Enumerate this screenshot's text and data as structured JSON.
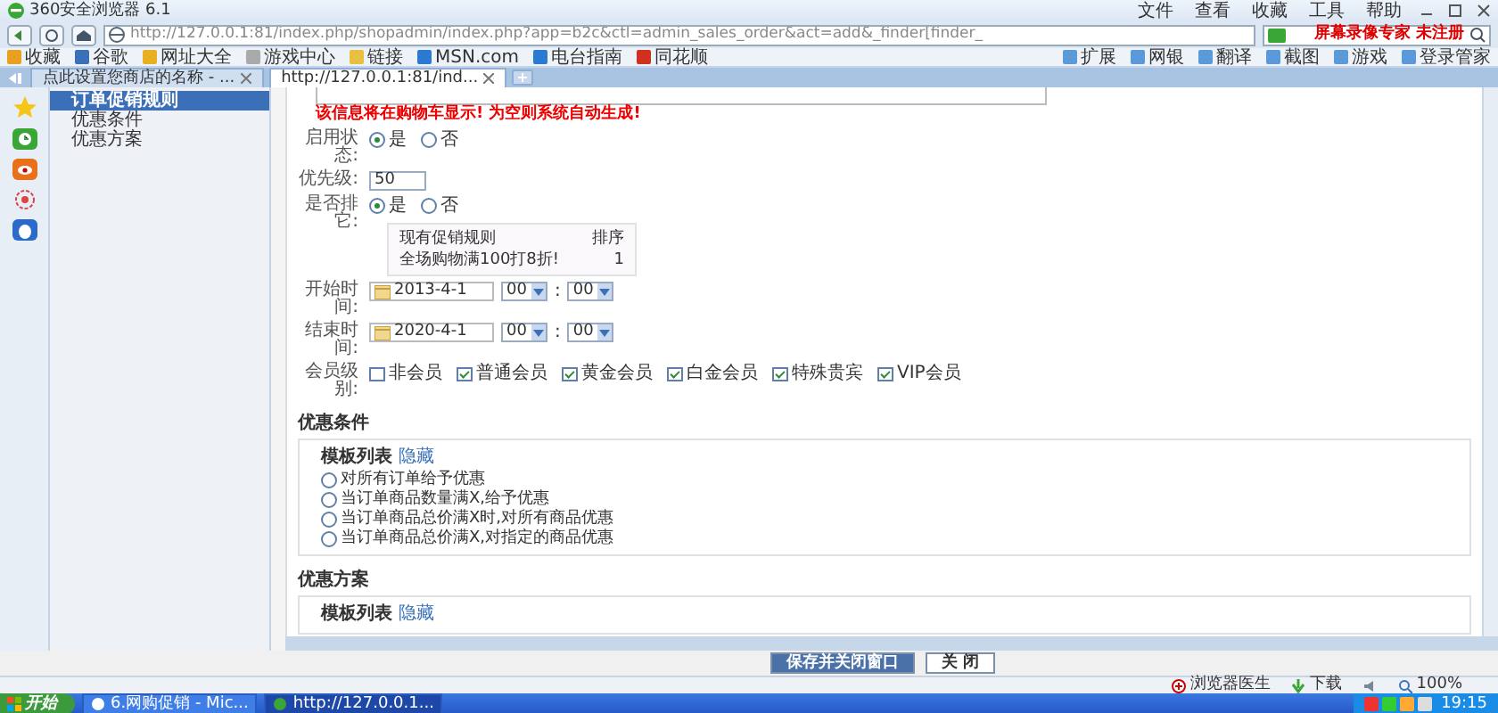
{
  "window": {
    "title": "360安全浏览器 6.1",
    "menu": [
      "文件",
      "查看",
      "收藏",
      "工具",
      "帮助"
    ]
  },
  "address_bar": {
    "url": "http://127.0.0.1:81/index.php/shopadmin/index.php?app=b2c&ctl=admin_sales_order&act=add&_finder[finder_",
    "search_value": "屏幕录像专家 未注册"
  },
  "bookmarks": [
    "收藏",
    "谷歌",
    "网址大全",
    "游戏中心",
    "链接",
    "MSN.com",
    "电台指南",
    "同花顺"
  ],
  "extensions": [
    "扩展",
    "网银",
    "翻译",
    "截图",
    "游戏",
    "登录管家"
  ],
  "tabs": [
    {
      "label": "点此设置您商店的名称 - ...",
      "selected": false
    },
    {
      "label": "http://127.0.0.1:81/ind...",
      "selected": true
    }
  ],
  "sidebar": {
    "items": [
      {
        "label": "订单促销规则",
        "selected": true
      },
      {
        "label": "优惠条件",
        "selected": false
      },
      {
        "label": "优惠方案",
        "selected": false
      }
    ]
  },
  "form": {
    "note": "该信息将在购物车显示! 为空则系统自动生成!",
    "status": {
      "label": "启用状态:",
      "options": [
        {
          "label": "是",
          "selected": true
        },
        {
          "label": "否",
          "selected": false
        }
      ]
    },
    "priority": {
      "label": "优先级:",
      "value": "50"
    },
    "exclusive": {
      "label": "是否排它:",
      "options": [
        {
          "label": "是",
          "selected": true
        },
        {
          "label": "否",
          "selected": false
        }
      ],
      "rules_table": {
        "columns": [
          "现有促销规则",
          "排序"
        ],
        "rows": [
          [
            "全场购物满100打8折!",
            "1"
          ]
        ]
      }
    },
    "times": [
      {
        "label": "开始时间:",
        "date": "2013-4-1",
        "hour": "00",
        "separator": ":",
        "minute": "00"
      },
      {
        "label": "结束时间:",
        "date": "2020-4-1",
        "hour": "00",
        "separator": ":",
        "minute": "00"
      }
    ],
    "member_levels": {
      "label": "会员级别:",
      "options": [
        {
          "label": "非会员",
          "checked": false
        },
        {
          "label": "普通会员",
          "checked": true
        },
        {
          "label": "黄金会员",
          "checked": true
        },
        {
          "label": "白金会员",
          "checked": true
        },
        {
          "label": "特殊贵宾",
          "checked": true
        },
        {
          "label": "VIP会员",
          "checked": true
        }
      ]
    }
  },
  "sections": [
    {
      "title": "优惠条件",
      "template_label": "模板列表",
      "toggle": "隐藏",
      "options": [
        {
          "label": "对所有订单给予优惠",
          "selected": false
        },
        {
          "label": "当订单商品数量满X,给予优惠",
          "selected": false
        },
        {
          "label": "当订单商品总价满X时,对所有商品优惠",
          "selected": false
        },
        {
          "label": "当订单商品总价满X,对指定的商品优惠",
          "selected": false
        }
      ]
    },
    {
      "title": "优惠方案",
      "template_label": "模板列表",
      "toggle": "隐藏"
    }
  ],
  "buttons": [
    {
      "label": "保存并关闭窗口",
      "kind": "primary"
    },
    {
      "label": "关 闭",
      "kind": "secondary"
    }
  ],
  "status_bar": {
    "items": [
      "浏览器医生",
      "下载"
    ],
    "zoom": "100%"
  },
  "taskbar": {
    "start": "开始",
    "tasks": [
      {
        "label": "6.网购促销 - Mic...",
        "selected": false
      },
      {
        "label": "http://127.0.0.1...",
        "selected": true
      }
    ],
    "clock": "19:15"
  }
}
